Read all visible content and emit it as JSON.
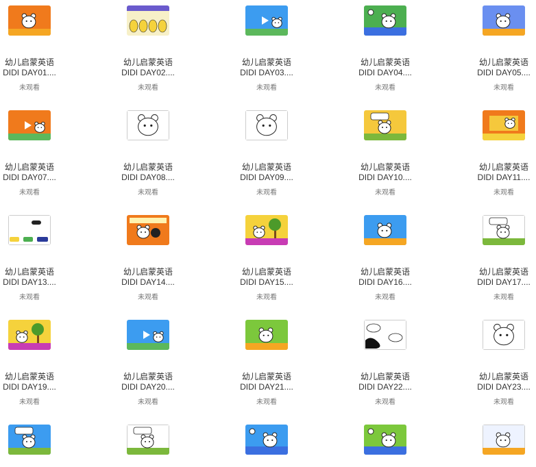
{
  "cards": [
    {
      "title": "幼儿启蒙英语",
      "subtitle": "DIDI DAY01....",
      "status": "未观看",
      "bg": "#f07a1c",
      "icon": "bear-scene-icon"
    },
    {
      "title": "幼儿启蒙英语",
      "subtitle": "DIDI DAY02....",
      "status": "未观看",
      "bg": "#f7f0c8",
      "icon": "crowd-scene-icon"
    },
    {
      "title": "幼儿启蒙英语",
      "subtitle": "DIDI DAY03....",
      "status": "未观看",
      "bg": "#3c9cf0",
      "icon": "play-icon"
    },
    {
      "title": "幼儿启蒙英语",
      "subtitle": "DIDI DAY04....",
      "status": "未观看",
      "bg": "#4caf50",
      "icon": "garden-scene-icon"
    },
    {
      "title": "幼儿启蒙英语",
      "subtitle": "DIDI DAY05....",
      "status": "未观看",
      "bg": "#6a8ff0",
      "icon": "bear-scene-icon"
    },
    {
      "title": "幼儿启蒙英语",
      "subtitle": "DIDI DAY07....",
      "status": "未观看",
      "bg": "#f07a1c",
      "icon": "play-icon"
    },
    {
      "title": "幼儿启蒙英语",
      "subtitle": "DIDI DAY08....",
      "status": "未观看",
      "bg": "#ffffff",
      "icon": "bear-outline-icon"
    },
    {
      "title": "幼儿启蒙英语",
      "subtitle": "DIDI DAY09....",
      "status": "未观看",
      "bg": "#ffffff",
      "icon": "bear-outline-icon"
    },
    {
      "title": "幼儿启蒙英语",
      "subtitle": "DIDI DAY10....",
      "status": "未观看",
      "bg": "#f5c83c",
      "icon": "speech-scene-icon"
    },
    {
      "title": "幼儿启蒙英语",
      "subtitle": "DIDI DAY11....",
      "status": "未观看",
      "bg": "#f07a1c",
      "icon": "shop-scene-icon"
    },
    {
      "title": "幼儿启蒙英语",
      "subtitle": "DIDI DAY13....",
      "status": "未观看",
      "bg": "#ffffff",
      "icon": "words-scene-icon"
    },
    {
      "title": "幼儿启蒙英语",
      "subtitle": "DIDI DAY14....",
      "status": "未观看",
      "bg": "#f07a1c",
      "icon": "stage-scene-icon"
    },
    {
      "title": "幼儿启蒙英语",
      "subtitle": "DIDI DAY15....",
      "status": "未观看",
      "bg": "#f5d23c",
      "icon": "tree-scene-icon"
    },
    {
      "title": "幼儿启蒙英语",
      "subtitle": "DIDI DAY16....",
      "status": "未观看",
      "bg": "#3c9cf0",
      "icon": "bear-scene-icon"
    },
    {
      "title": "幼儿启蒙英语",
      "subtitle": "DIDI DAY17....",
      "status": "未观看",
      "bg": "#ffffff",
      "icon": "speech-scene-icon"
    },
    {
      "title": "幼儿启蒙英语",
      "subtitle": "DIDI DAY19....",
      "status": "未观看",
      "bg": "#f5d23c",
      "icon": "tree-scene-icon"
    },
    {
      "title": "幼儿启蒙英语",
      "subtitle": "DIDI DAY20....",
      "status": "未观看",
      "bg": "#3c9cf0",
      "icon": "play-icon"
    },
    {
      "title": "幼儿启蒙英语",
      "subtitle": "DIDI DAY21....",
      "status": "未观看",
      "bg": "#7cc83c",
      "icon": "bear-scene-icon"
    },
    {
      "title": "幼儿启蒙英语",
      "subtitle": "DIDI DAY22....",
      "status": "未观看",
      "bg": "#ffffff",
      "icon": "cloud-scene-icon"
    },
    {
      "title": "幼儿启蒙英语",
      "subtitle": "DIDI DAY23....",
      "status": "未观看",
      "bg": "#ffffff",
      "icon": "bear-outline-icon"
    },
    {
      "title": "",
      "subtitle": "",
      "status": "",
      "bg": "#3c9cf0",
      "icon": "speech-scene-icon"
    },
    {
      "title": "",
      "subtitle": "",
      "status": "",
      "bg": "#ffffff",
      "icon": "speech-scene-icon"
    },
    {
      "title": "",
      "subtitle": "",
      "status": "",
      "bg": "#3c9cf0",
      "icon": "garden-scene-icon"
    },
    {
      "title": "",
      "subtitle": "",
      "status": "",
      "bg": "#7cc83c",
      "icon": "garden-scene-icon"
    },
    {
      "title": "",
      "subtitle": "",
      "status": "",
      "bg": "#eef3ff",
      "icon": "bear-scene-icon"
    }
  ]
}
